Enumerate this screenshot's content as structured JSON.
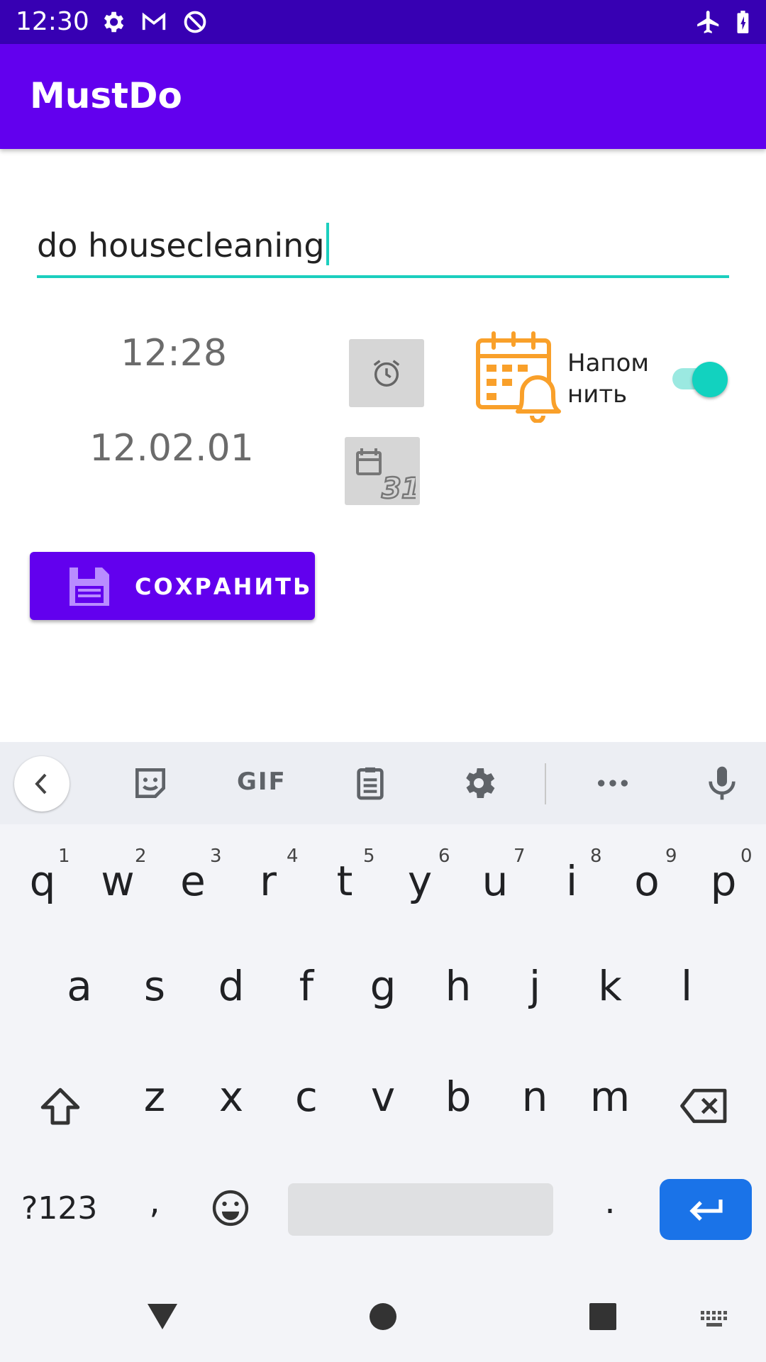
{
  "status_bar": {
    "time": "12:30",
    "icons": [
      "gear-icon",
      "gmail-icon",
      "data-saver-icon",
      "airplane-mode-icon",
      "battery-charging-icon"
    ]
  },
  "app_bar": {
    "title": "MustDo"
  },
  "form": {
    "task_value": "do housecleaning",
    "time_value": "12:28",
    "date_value": "12.02.01",
    "remind_label_line1": "Напом",
    "remind_label_line2": "нить",
    "remind_enabled": true,
    "save_label": "СОХРАНИТЬ"
  },
  "colors": {
    "status_bar": "#3700b3",
    "app_bar": "#6200ee",
    "accent": "#12d2bf",
    "reminder_icon": "#f9a02a",
    "enter_key": "#1a73e8"
  },
  "keyboard": {
    "toolbar_gif": "GIF",
    "row1": [
      "q",
      "w",
      "e",
      "r",
      "t",
      "y",
      "u",
      "i",
      "o",
      "p"
    ],
    "row1_hints": [
      "1",
      "2",
      "3",
      "4",
      "5",
      "6",
      "7",
      "8",
      "9",
      "0"
    ],
    "row2": [
      "a",
      "s",
      "d",
      "f",
      "g",
      "h",
      "j",
      "k",
      "l"
    ],
    "row3": [
      "z",
      "x",
      "c",
      "v",
      "b",
      "n",
      "m"
    ],
    "symbols_label": "?123",
    "comma": ",",
    "period": "."
  }
}
